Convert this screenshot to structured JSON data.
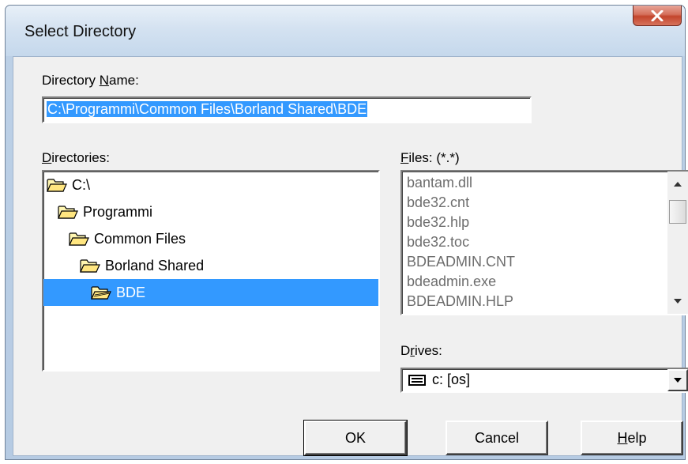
{
  "window": {
    "title": "Select Directory"
  },
  "directory_name": {
    "label_prefix": "Directory ",
    "label_accel": "N",
    "label_suffix": "ame:",
    "value": "C:\\Programmi\\Common Files\\Borland Shared\\BDE"
  },
  "directories": {
    "label_accel": "D",
    "label_suffix": "irectories:",
    "items": [
      {
        "label": "C:\\",
        "icon": "folder-open-icon",
        "selected": false
      },
      {
        "label": "Programmi",
        "icon": "folder-open-icon",
        "selected": false
      },
      {
        "label": "Common Files",
        "icon": "folder-open-icon",
        "selected": false
      },
      {
        "label": "Borland Shared",
        "icon": "folder-open-icon",
        "selected": false
      },
      {
        "label": "BDE",
        "icon": "folder-open-icon",
        "selected": true
      }
    ]
  },
  "files": {
    "label_accel": "F",
    "label_suffix": "iles: (*.*)",
    "items": [
      "bantam.dll",
      "bde32.cnt",
      "bde32.hlp",
      "bde32.toc",
      "BDEADMIN.CNT",
      "bdeadmin.exe",
      "BDEADMIN.HLP"
    ]
  },
  "drives": {
    "label_prefix": "D",
    "label_accel": "r",
    "label_suffix": "ives:",
    "value": "c: [os]",
    "icon": "drive-icon"
  },
  "buttons": {
    "ok": "OK",
    "cancel": "Cancel",
    "help_accel": "H",
    "help_suffix": "elp"
  },
  "colors": {
    "selection": "#3399ff",
    "dialog_bg": "#f0f0f0",
    "close_button": "#c3452c",
    "file_text": "#6d6d6d"
  }
}
